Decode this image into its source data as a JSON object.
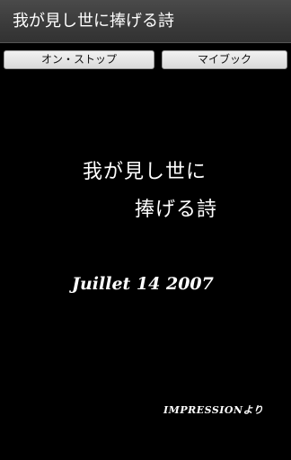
{
  "app": {
    "title": "我が見し世に捧げる詩"
  },
  "toolbar": {
    "on_stop_label": "オン・ストップ",
    "my_book_label": "マイブック"
  },
  "content": {
    "poem_line1": "我が見し世に",
    "poem_line2": "捧げる詩",
    "date": "Juillet 14 2007",
    "credit": "IMPRESSIONより"
  },
  "colors": {
    "background": "#000000",
    "title_bar": "#3a3a3a",
    "text": "#ffffff",
    "button": "#e6e6e6"
  }
}
